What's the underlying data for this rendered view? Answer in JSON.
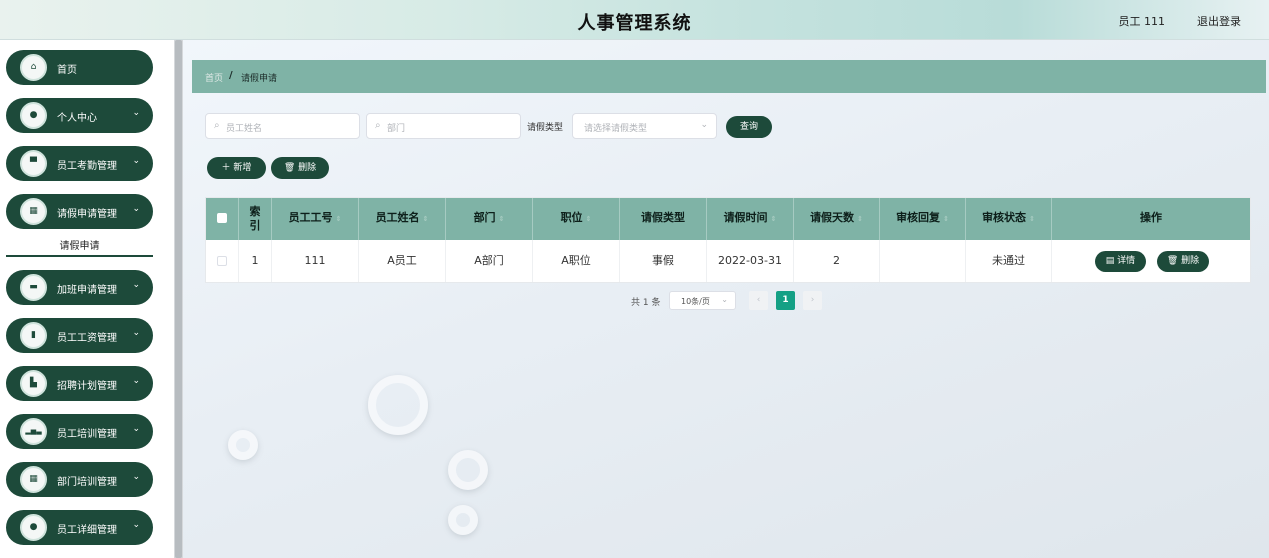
{
  "header": {
    "title": "人事管理系统",
    "user": "员工 111",
    "logout": "退出登录"
  },
  "sidebar": {
    "items": [
      {
        "label": "首页",
        "icon": "home-icon",
        "glyph": "⌂",
        "chevron": false
      },
      {
        "label": "个人中心",
        "icon": "person-icon",
        "glyph": "●",
        "chevron": true
      },
      {
        "label": "员工考勤管理",
        "icon": "monitor-icon",
        "glyph": "▀",
        "chevron": true
      },
      {
        "label": "请假申请管理",
        "icon": "grid-icon",
        "glyph": "▦",
        "chevron": true
      },
      {
        "label": "加班申请管理",
        "icon": "briefcase-icon",
        "glyph": "▬",
        "chevron": true
      },
      {
        "label": "员工工资管理",
        "icon": "clipboard-icon",
        "glyph": "▮",
        "chevron": true
      },
      {
        "label": "招聘计划管理",
        "icon": "building-icon",
        "glyph": "▙",
        "chevron": true
      },
      {
        "label": "员工培训管理",
        "icon": "bar-chart-icon",
        "glyph": "▂▅▃",
        "chevron": true
      },
      {
        "label": "部门培训管理",
        "icon": "grid-icon",
        "glyph": "▦",
        "chevron": true
      },
      {
        "label": "员工详细管理",
        "icon": "location-icon",
        "glyph": "●",
        "chevron": true
      }
    ],
    "active_sub": "请假申请"
  },
  "breadcrumb": {
    "home": "首页",
    "separator": "/",
    "current": "请假申请"
  },
  "search": {
    "name_placeholder": "员工姓名",
    "dept_placeholder": "部门",
    "type_label": "请假类型",
    "type_placeholder": "请选择请假类型",
    "query": "查询"
  },
  "actions": {
    "add": "新增",
    "delete": "删除"
  },
  "table": {
    "headers": [
      "索引",
      "员工工号",
      "员工姓名",
      "部门",
      "职位",
      "请假类型",
      "请假时间",
      "请假天数",
      "审核回复",
      "审核状态",
      "操作"
    ],
    "rows": [
      {
        "index": "1",
        "emp_no": "111",
        "emp_name": "A员工",
        "dept": "A部门",
        "position": "A职位",
        "leave_type": "事假",
        "leave_date": "2022-03-31",
        "days": "2",
        "reply": "",
        "status": "未通过"
      }
    ],
    "row_actions": {
      "detail": "详情",
      "delete": "删除"
    }
  },
  "pagination": {
    "total": "共 1 条",
    "page_size": "10条/页",
    "current_page": "1",
    "prev": "‹",
    "next": "›"
  },
  "colors": {
    "primary": "#1d4a3a",
    "header_teal": "#7fb3a6",
    "active_page": "#14a085"
  }
}
